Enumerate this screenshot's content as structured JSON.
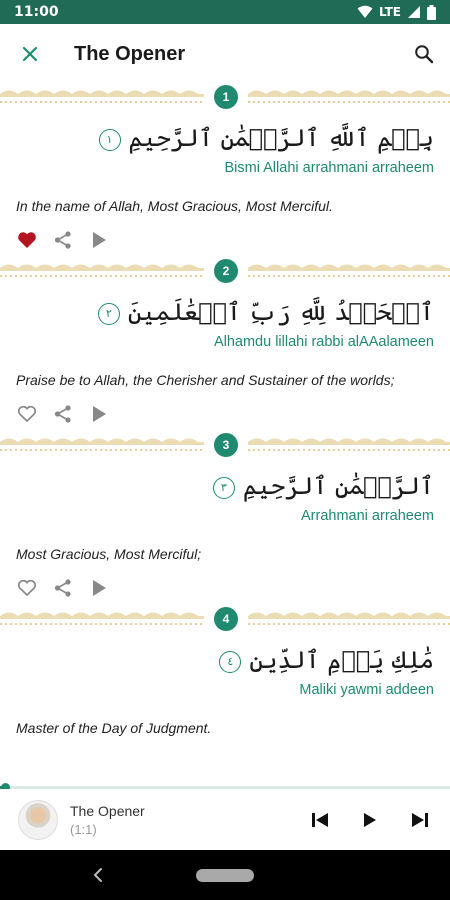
{
  "status_bar": {
    "time": "11:00",
    "network": "LTE"
  },
  "app_bar": {
    "title": "The Opener"
  },
  "verses": [
    {
      "number": "1",
      "arabic": "بِسۡمِ ٱللَّهِ ٱلرَّحۡمَٰنِ ٱلرَّحِيمِ",
      "ayah_mark": "١",
      "transliteration": "Bismi Allahi arrahmani arraheem",
      "translation": "In the name of Allah, Most Gracious, Most Merciful.",
      "favorited": true
    },
    {
      "number": "2",
      "arabic": "ٱلۡحَمۡدُ لِلَّهِ رَبِّ ٱلۡعَٰلَمِينَ",
      "ayah_mark": "٢",
      "transliteration": "Alhamdu lillahi rabbi alAAalameen",
      "translation": "Praise be to Allah, the Cherisher and Sustainer of the worlds;",
      "favorited": false
    },
    {
      "number": "3",
      "arabic": "ٱلرَّحۡمَٰنِ ٱلرَّحِيمِ",
      "ayah_mark": "٣",
      "transliteration": "Arrahmani arraheem",
      "translation": "Most Gracious, Most Merciful;",
      "favorited": false
    },
    {
      "number": "4",
      "arabic": "مَٰلِكِ يَوۡمِ ٱلدِّينِ",
      "ayah_mark": "٤",
      "transliteration": "Maliki yawmi addeen",
      "translation": "Master of the Day of Judgment.",
      "favorited": false
    }
  ],
  "player": {
    "title": "The Opener",
    "subtitle": "(1:1)",
    "progress": 0.01
  },
  "colors": {
    "accent": "#1f8a70",
    "header": "#1f6b55",
    "favorite": "#b3141f",
    "divider": "#ecdcb4"
  },
  "icons": {
    "close": "close-icon",
    "search": "search-icon",
    "favorite": "heart-icon",
    "share": "share-icon",
    "play": "play-icon",
    "previous": "skip-previous-icon",
    "next": "skip-next-icon"
  }
}
